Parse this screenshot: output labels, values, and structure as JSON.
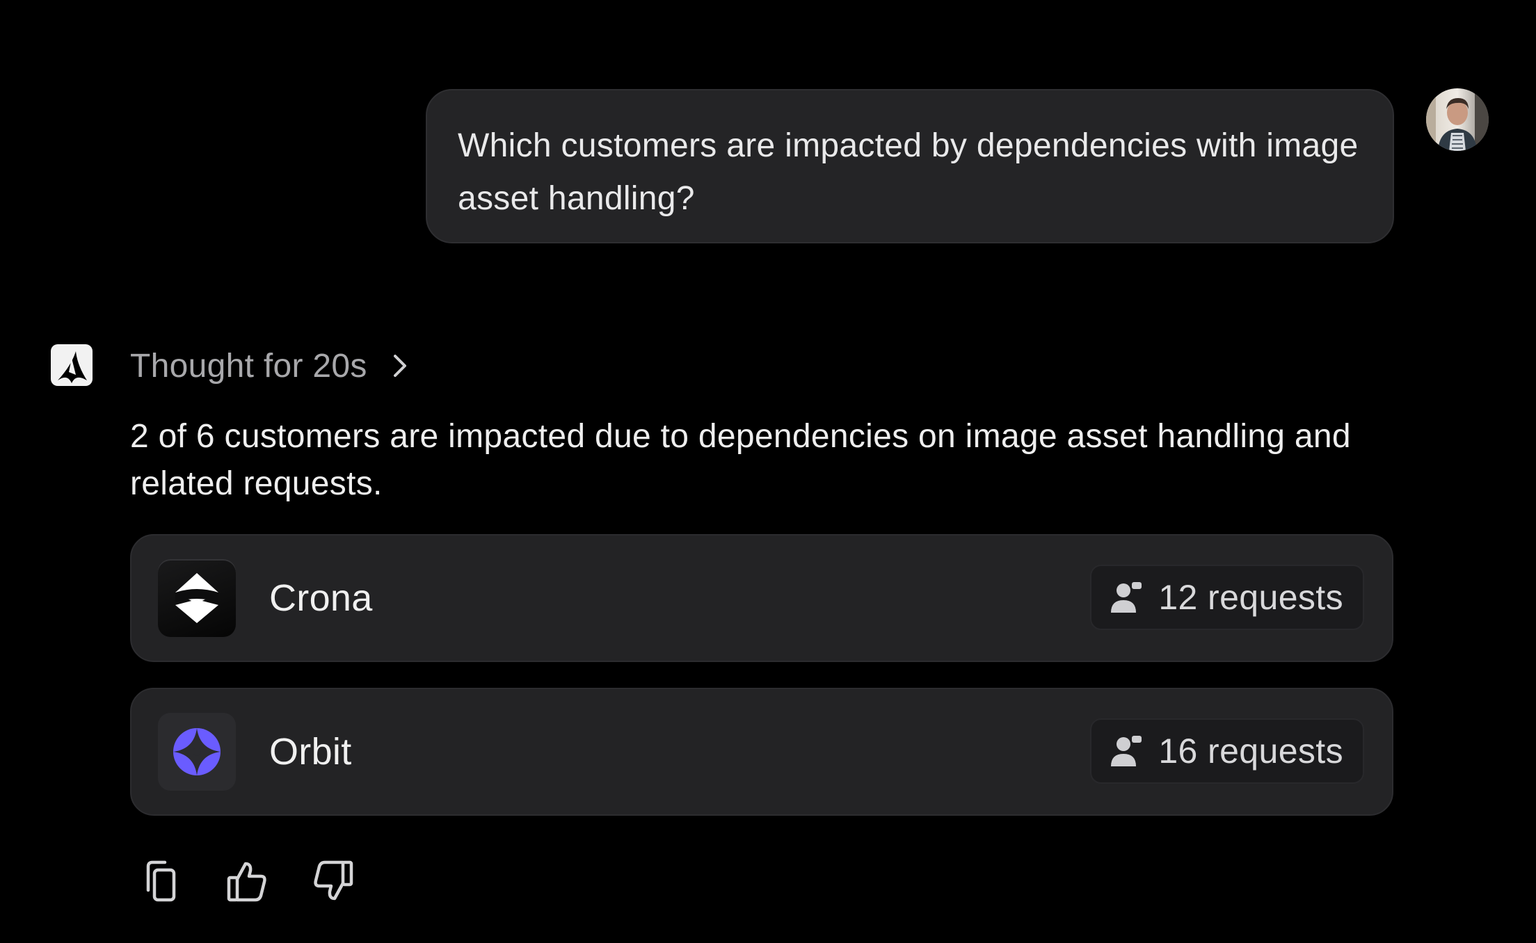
{
  "user_message": {
    "text": "Which customers are impacted by dependencies with image asset handling?",
    "avatar_icon": "user-avatar"
  },
  "assistant": {
    "logo_icon": "assistant-logo-icon",
    "thought_label": "Thought for 20s",
    "thought_icon": "chevron-right-icon",
    "summary": "2 of 6 customers are impacted due to dependencies on image asset handling and related requests.",
    "customers": [
      {
        "name": "Crona",
        "requests": "12 requests",
        "logo_icon": "crona-logo-icon",
        "badge_icon": "person-icon"
      },
      {
        "name": "Orbit",
        "requests": "16 requests",
        "logo_icon": "orbit-logo-icon",
        "badge_icon": "person-icon",
        "logo_color": "#6a5cff"
      }
    ],
    "actions": [
      {
        "name": "copy",
        "icon": "copy-icon"
      },
      {
        "name": "thumbs-up",
        "icon": "thumbs-up-icon"
      },
      {
        "name": "thumbs-down",
        "icon": "thumbs-down-icon"
      }
    ]
  },
  "colors": {
    "background": "#000000",
    "bubble": "#242426",
    "card": "#232325",
    "muted_text": "#a8a8ab",
    "orbit_accent": "#6a5cff"
  }
}
